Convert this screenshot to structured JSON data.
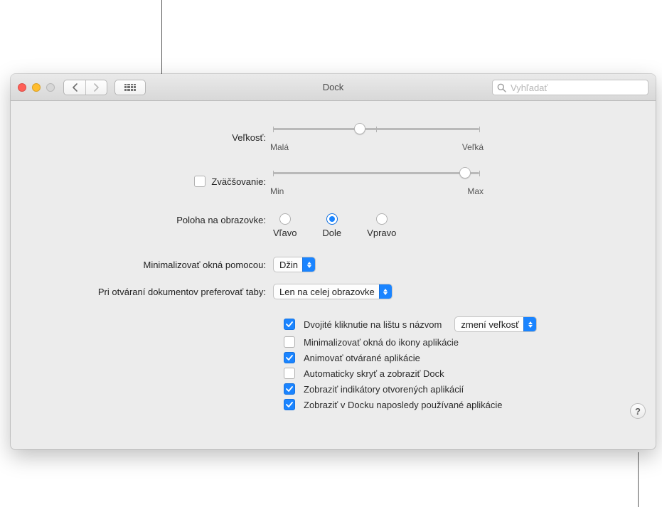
{
  "title": "Dock",
  "search": {
    "placeholder": "Vyhľadať"
  },
  "size": {
    "label": "Veľkosť:",
    "min_label": "Malá",
    "max_label": "Veľká",
    "value_pct": 42
  },
  "magnification": {
    "label": "Zväčšovanie:",
    "checked": false,
    "min_label": "Min",
    "max_label": "Max",
    "value_pct": 93
  },
  "position": {
    "label": "Poloha na obrazovke:",
    "options": [
      {
        "label": "Vľavo"
      },
      {
        "label": "Dole"
      },
      {
        "label": "Vpravo"
      }
    ],
    "selected_index": 1
  },
  "minimize_effect": {
    "label": "Minimalizovať okná pomocou:",
    "value": "Džin"
  },
  "prefer_tabs": {
    "label": "Pri otváraní dokumentov preferovať taby:",
    "value": "Len na celej obrazovke"
  },
  "titlebar_doubleclick": {
    "checked": true,
    "label": "Dvojité kliknutie na lištu s názvom",
    "action_value": "zmení veľkosť"
  },
  "minimize_into_icon": {
    "checked": false,
    "label": "Minimalizovať okná do ikony aplikácie"
  },
  "animate_opening": {
    "checked": true,
    "label": "Animovať otvárané aplikácie"
  },
  "autohide": {
    "checked": false,
    "label": "Automaticky skryť a zobraziť Dock"
  },
  "show_indicators": {
    "checked": true,
    "label": "Zobraziť indikátory otvorených aplikácií"
  },
  "show_recent": {
    "checked": true,
    "label": "Zobraziť v Docku naposledy používané aplikácie"
  },
  "help_symbol": "?"
}
